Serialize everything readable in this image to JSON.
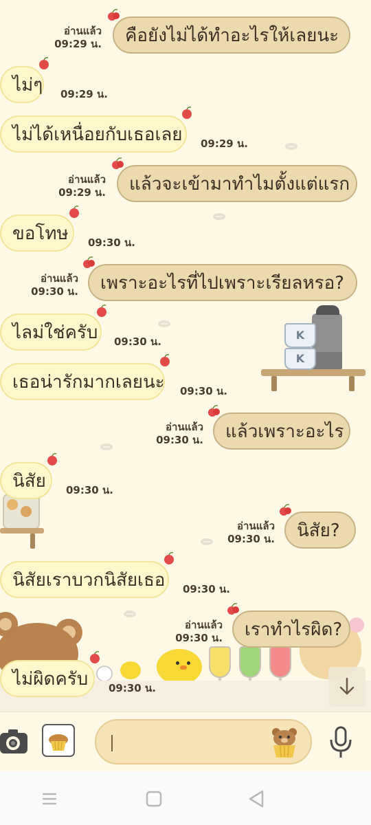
{
  "messages": [
    {
      "side": "out",
      "text": "คือยังไม่ได้ทำอะไรให้เลยนะ",
      "read": "อ่านแล้ว",
      "time": "09:29 น."
    },
    {
      "side": "in",
      "text": "ไม่ๆ",
      "time": "09:29 น."
    },
    {
      "side": "in",
      "text": "ไม่ได้เหนื่อยกับเธอเลย",
      "time": "09:29 น."
    },
    {
      "side": "out",
      "text": "แล้วจะเข้ามาทำไมตั้งแต่แรก",
      "read": "อ่านแล้ว",
      "time": "09:29 น."
    },
    {
      "side": "in",
      "text": "ขอโทษ",
      "time": "09:30 น."
    },
    {
      "side": "out",
      "text": "เพราะอะไรที่ไปเพราะเรียลหรอ?",
      "read": "อ่านแล้ว",
      "time": "09:30 น."
    },
    {
      "side": "in",
      "text": "ไลม่ใช่ครับ",
      "time": "09:30 น."
    },
    {
      "side": "in",
      "text": "เธอน่ารักมากเลยนะ",
      "time": "09:30 น."
    },
    {
      "side": "out",
      "text": "แล้วเพราะอะไร",
      "read": "อ่านแล้ว",
      "time": "09:30 น."
    },
    {
      "side": "in",
      "text": "นิสัย",
      "time": "09:30 น."
    },
    {
      "side": "out",
      "text": "นิสัย?",
      "read": "อ่านแล้ว",
      "time": "09:30 น."
    },
    {
      "side": "in",
      "text": "นิสัยเราบวกนิสัยเธอ",
      "time": "09:30 น."
    },
    {
      "side": "out",
      "text": "เราทำไรผิด?",
      "read": "อ่านแล้ว",
      "time": "09:30 น."
    },
    {
      "side": "in",
      "text": "ไม่ผิดครับ",
      "time": "09:30 น."
    }
  ],
  "input": {
    "placeholder": ""
  },
  "icons": {
    "camera": "camera-icon",
    "gallery": "muffin-sticker-icon",
    "sticker": "bear-muffin-sticker-icon",
    "mic": "microphone-icon",
    "scroll": "arrow-down-icon",
    "recents": "menu-icon",
    "home": "square-icon",
    "back": "triangle-back-icon"
  },
  "colors": {
    "background": "#fdf9e6",
    "incoming_bubble": "#fff8cc",
    "outgoing_bubble": "#ebd9b0",
    "input_field": "#f6e3b8",
    "cherry": "#e34b4b"
  }
}
